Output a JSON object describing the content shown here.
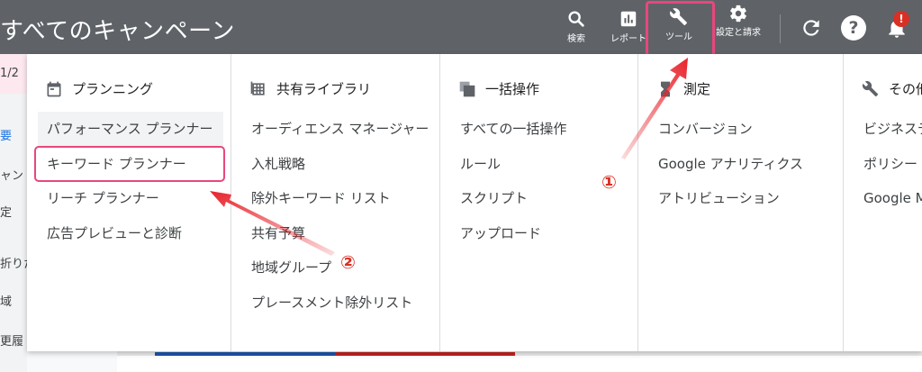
{
  "app": {
    "title": "すべてのキャンペーン"
  },
  "toolbar": {
    "search_label": "検索",
    "reports_label": "レポート",
    "tools_label": "ツール",
    "settings_label": "設定と請求"
  },
  "notifications": {
    "badge": "!"
  },
  "help": {
    "glyph": "?"
  },
  "background": {
    "left_items": [
      "1/2",
      "要",
      "ャン",
      "定",
      "折りた",
      "域",
      "更履"
    ]
  },
  "menu": {
    "columns": [
      {
        "header": "プランニング",
        "icon": "calendar-icon",
        "items": [
          "パフォーマンス プランナー",
          "キーワード プランナー",
          "リーチ プランナー",
          "広告プレビューと診断"
        ]
      },
      {
        "header": "共有ライブラリ",
        "icon": "grid-icon",
        "items": [
          "オーディエンス マネージャー",
          "入札戦略",
          "除外キーワード リスト",
          "共有予算",
          "地域グループ",
          "プレースメント除外リスト"
        ]
      },
      {
        "header": "一括操作",
        "icon": "copy-icon",
        "items": [
          "すべての一括操作",
          "ルール",
          "スクリプト",
          "アップロード"
        ]
      },
      {
        "header": "測定",
        "icon": "hourglass-icon",
        "items": [
          "コンバージョン",
          "Google アナリティクス",
          "アトリビューション"
        ]
      },
      {
        "header": "その他",
        "icon": "wrench-icon",
        "items": [
          "ビジネスデ",
          "ポリシー マ",
          "Google Me"
        ]
      }
    ]
  },
  "annotations": {
    "step1": "①",
    "step2": "②"
  },
  "colors": {
    "topbar": "#5f6368",
    "highlight": "#e8477c",
    "arrow": "#e8242c"
  }
}
